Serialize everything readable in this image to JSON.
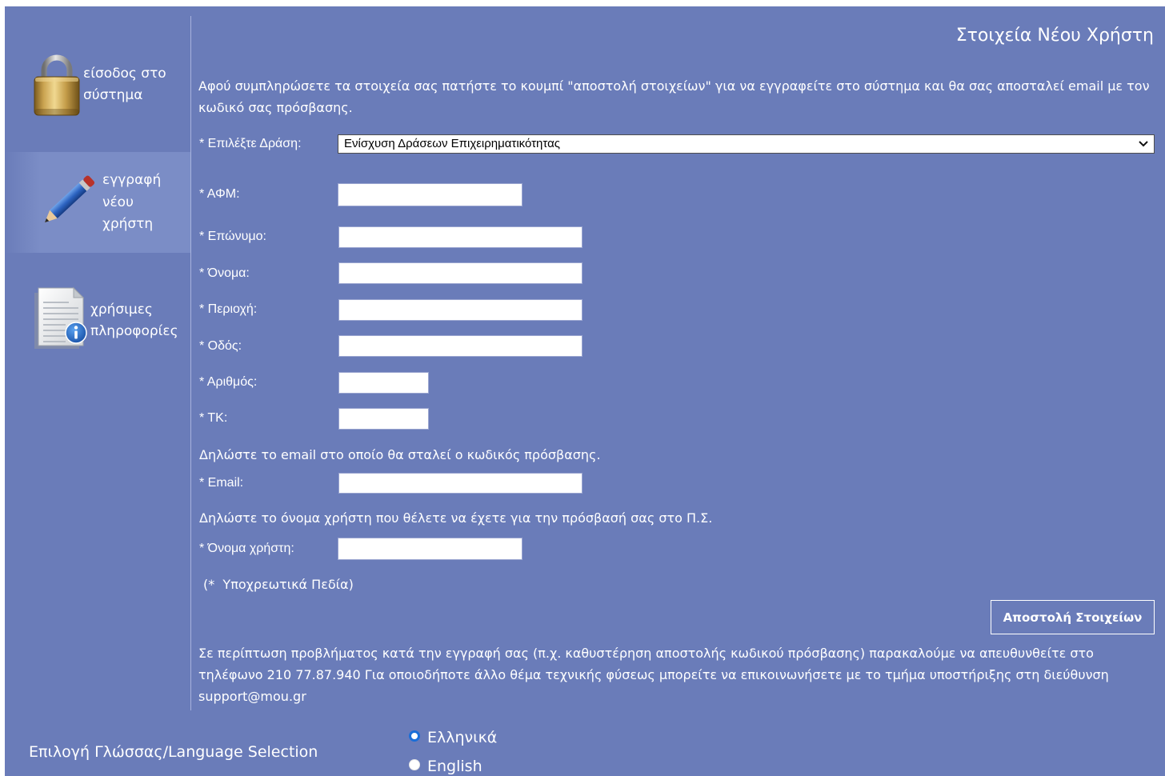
{
  "theme": {
    "background": "#6a7cb9",
    "selected_item": "#7b8dc6",
    "text": "#ffffff",
    "radio_accent": "#1a6ed8"
  },
  "sidebar": {
    "items": [
      {
        "icon": "lock-icon",
        "lines": [
          "είσοδος στο",
          "σύστημα"
        ],
        "selected": false
      },
      {
        "icon": "pencil-icon",
        "lines": [
          "εγγραφή",
          "νέου",
          "χρήστη"
        ],
        "selected": true
      },
      {
        "icon": "document-info-icon",
        "lines": [
          "χρήσιμες",
          "πληροφορίες"
        ],
        "selected": false
      }
    ]
  },
  "page": {
    "title": "Στοιχεία Νέου Χρήστη",
    "intro": "Αφού συμπληρώσετε τα στοιχεία σας πατήστε το κουμπί \"αποστολή στοιχείων\" για να εγγραφείτε στο σύστημα και θα σας αποσταλεί email με τον κωδικό σας πρόσβασης."
  },
  "form": {
    "action": {
      "label": "* Επιλέξτε Δράση:",
      "selected": "Ενίσχυση Δράσεων Επιχειρηματικότητας"
    },
    "fields": [
      {
        "label": "* ΑΦΜ:",
        "value": ""
      },
      {
        "label": "* Επώνυμο:",
        "value": ""
      },
      {
        "label": "* Όνομα:",
        "value": ""
      },
      {
        "label": "* Περιοχή:",
        "value": ""
      },
      {
        "label": "* Οδός:",
        "value": ""
      },
      {
        "label": "* Αριθμός:",
        "value": ""
      },
      {
        "label": "* ΤΚ:",
        "value": ""
      }
    ],
    "email_note": "Δηλώστε το email στο οποίο θα σταλεί ο κωδικός πρόσβασης.",
    "email": {
      "label": "* Email:",
      "value": ""
    },
    "username_note": "Δηλώστε το όνομα χρήστη που θέλετε να έχετε για την πρόσβασή σας στο Π.Σ.",
    "username": {
      "label": "* Όνομα χρήστη:",
      "value": ""
    },
    "required_note": "(*  Υποχρεωτικά Πεδία)",
    "submit_label": "Αποστολή Στοιχείων"
  },
  "support_text": "Σε περίπτωση προβλήματος κατά την εγγραφή σας (π.χ. καθυστέρηση αποστολής κωδικού πρόσβασης) παρακαλούμε να απευθυνθείτε στο τηλέφωνο 210 77.87.940 Για οποιοδήποτε άλλο θέμα τεχνικής φύσεως μπορείτε να επικοινωνήσετε με το τμήμα υποστήριξης στη διεύθυνση support@mou.gr",
  "language": {
    "label": "Επιλογή Γλώσσας/Language Selection",
    "options": [
      {
        "label": "Ελληνικά",
        "checked": true
      },
      {
        "label": "English",
        "checked": false
      }
    ]
  }
}
